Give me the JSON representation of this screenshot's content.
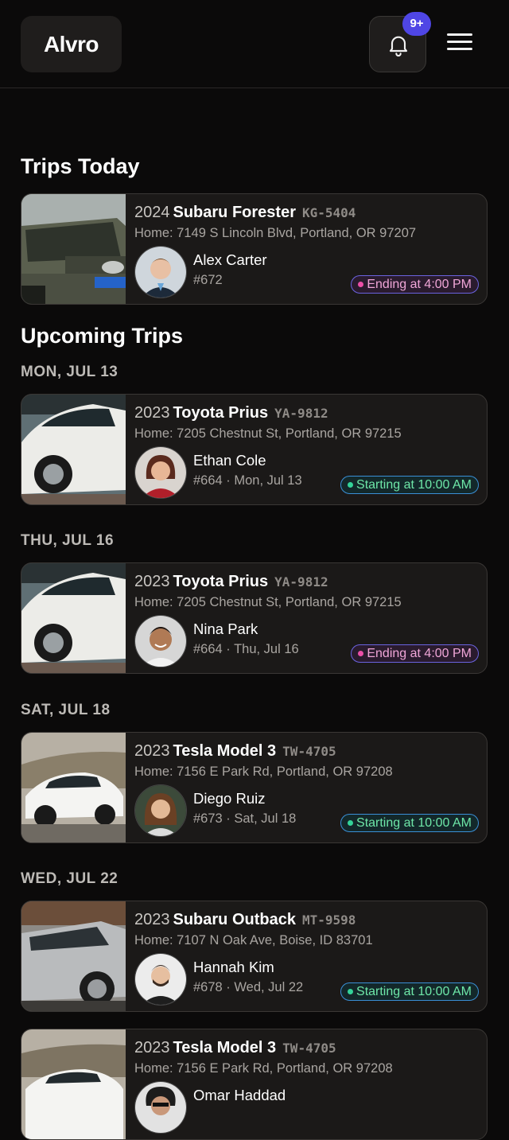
{
  "header": {
    "logo": "Alvro",
    "notification_badge": "9+",
    "icons": {
      "bell": "bell-icon",
      "menu": "hamburger-menu-icon"
    },
    "accent_color": "#4f46e5"
  },
  "today": {
    "title": "Trips Today",
    "trips": [
      {
        "year": "2024",
        "model": "Subaru Forester",
        "plate": "KG-5404",
        "address": "Home: 7149 S Lincoln Blvd, Portland, OR 97207",
        "name": "Alex Carter",
        "meta": "#672",
        "status": "Ending at 4:00 PM",
        "status_type": "ending"
      }
    ]
  },
  "upcoming": {
    "title": "Upcoming Trips",
    "groups": [
      {
        "date": "MON, JUL 13",
        "trip": {
          "year": "2023",
          "model": "Toyota Prius",
          "plate": "YA-9812",
          "address": "Home: 7205 Chestnut St, Portland, OR 97215",
          "name": "Ethan Cole",
          "meta": "#664 · Mon, Jul 13",
          "status": "Starting at 10:00 AM",
          "status_type": "starting"
        }
      },
      {
        "date": "THU, JUL 16",
        "trip": {
          "year": "2023",
          "model": "Toyota Prius",
          "plate": "YA-9812",
          "address": "Home: 7205 Chestnut St, Portland, OR 97215",
          "name": "Nina Park",
          "meta": "#664 · Thu, Jul 16",
          "status": "Ending at 4:00 PM",
          "status_type": "ending"
        }
      },
      {
        "date": "SAT, JUL 18",
        "trip": {
          "year": "2023",
          "model": "Tesla Model 3",
          "plate": "TW-4705",
          "address": "Home: 7156 E Park Rd, Portland, OR 97208",
          "name": "Diego Ruiz",
          "meta": "#673 · Sat, Jul 18",
          "status": "Starting at 10:00 AM",
          "status_type": "starting"
        }
      },
      {
        "date": "WED, JUL 22",
        "trip": {
          "year": "2023",
          "model": "Subaru Outback",
          "plate": "MT-9598",
          "address": "Home: 7107 N Oak Ave, Boise, ID 83701",
          "name": "Hannah Kim",
          "meta": "#678 · Wed, Jul 22",
          "status": "Starting at 10:00 AM",
          "status_type": "starting"
        }
      }
    ],
    "partial_trip": {
      "year": "2023",
      "model": "Tesla Model 3",
      "plate": "TW-4705",
      "address": "Home: 7156 E Park Rd, Portland, OR 97208",
      "name": "Omar Haddad"
    }
  },
  "status_colors": {
    "ending": "#ec4fa8",
    "starting": "#34d399"
  }
}
